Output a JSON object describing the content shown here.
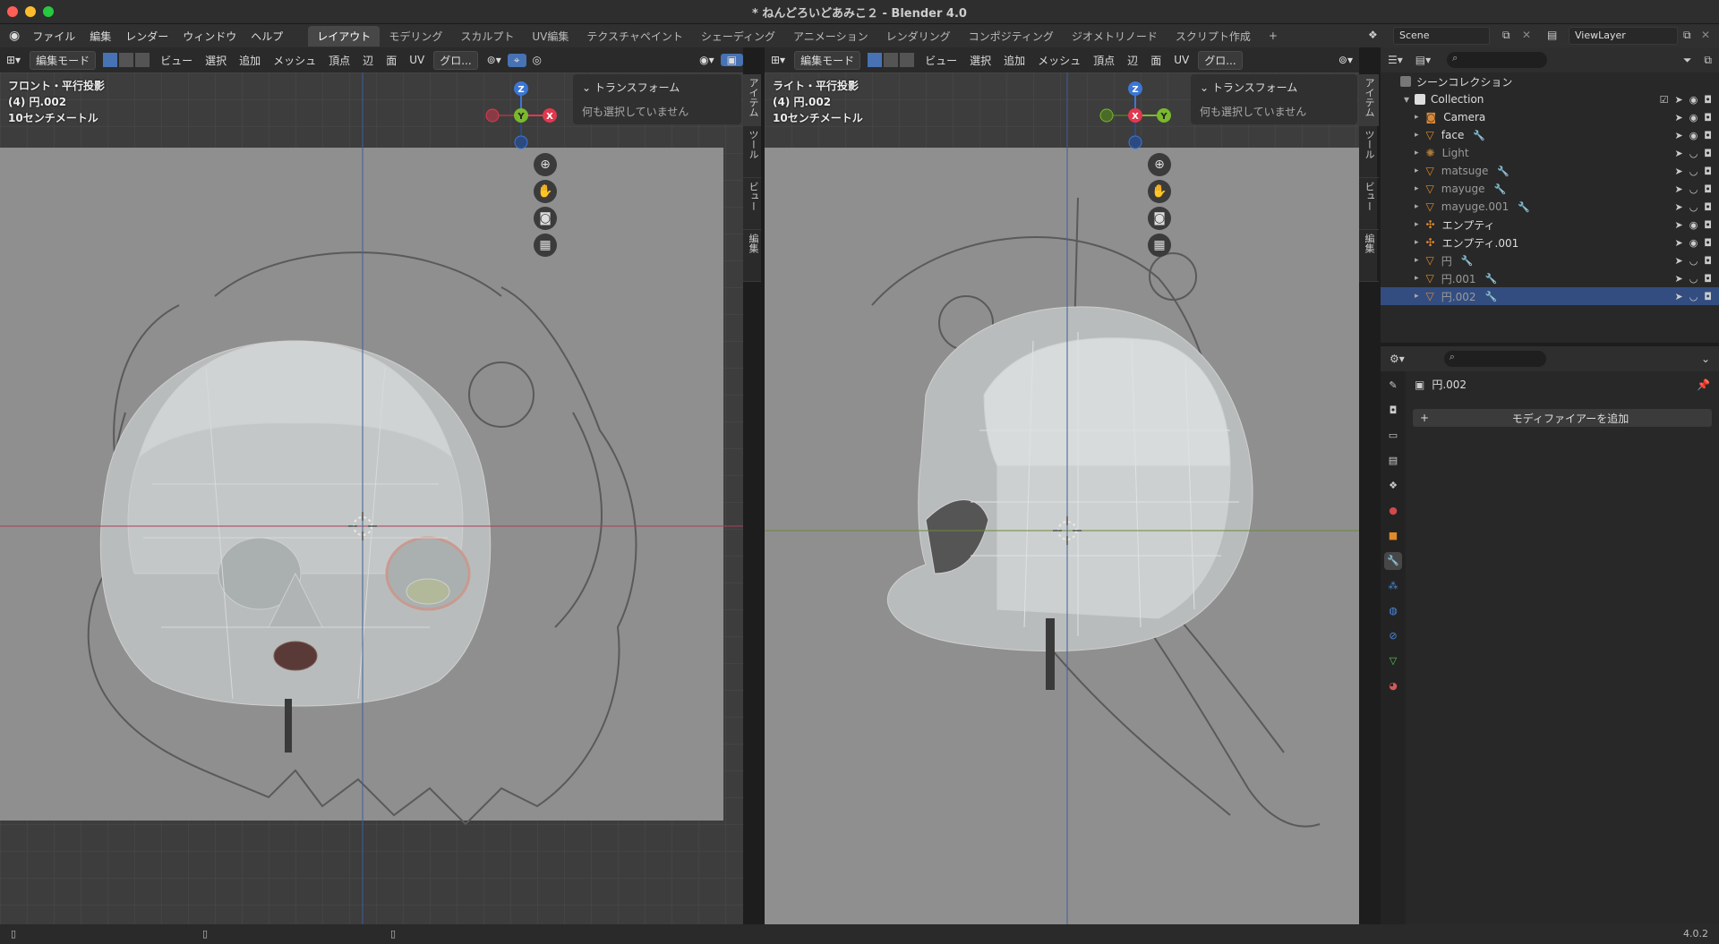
{
  "window": {
    "title": "* ねんどろいどあみこ２ - Blender 4.0"
  },
  "menus": [
    "ファイル",
    "編集",
    "レンダー",
    "ウィンドウ",
    "ヘルプ"
  ],
  "workspaces": [
    "レイアウト",
    "モデリング",
    "スカルプト",
    "UV編集",
    "テクスチャペイント",
    "シェーディング",
    "アニメーション",
    "レンダリング",
    "コンポジティング",
    "ジオメトリノード",
    "スクリプト作成"
  ],
  "workspace_add": "+",
  "scene": {
    "name": "Scene",
    "view_layer": "ViewLayer"
  },
  "viewport_left": {
    "mode": "編集モード",
    "menus": [
      "ビュー",
      "選択",
      "追加",
      "メッシュ",
      "頂点",
      "辺",
      "面",
      "UV"
    ],
    "transform_orient": "グロ...",
    "info_line1": "フロント・平行投影",
    "info_line2": "(4) 円.002",
    "info_line3": "10センチメートル",
    "panel_title": "トランスフォーム",
    "panel_body": "何も選択していません",
    "gizmo": {
      "top": "Z",
      "center": "Y",
      "right": "X"
    },
    "tabs": [
      "アイテム",
      "ツール",
      "ビュー",
      "編集"
    ]
  },
  "viewport_right": {
    "mode": "編集モード",
    "menus": [
      "ビュー",
      "選択",
      "追加",
      "メッシュ",
      "頂点",
      "辺",
      "面",
      "UV"
    ],
    "transform_orient": "グロ...",
    "info_line1": "ライト・平行投影",
    "info_line2": "(4) 円.002",
    "info_line3": "10センチメートル",
    "panel_title": "トランスフォーム",
    "panel_body": "何も選択していません",
    "gizmo": {
      "top": "Z",
      "center": "X",
      "right": "Y"
    },
    "tabs": [
      "アイテム",
      "ツール",
      "ビュー",
      "編集"
    ]
  },
  "outliner": {
    "root": "シーンコレクション",
    "collection": "Collection",
    "items": [
      {
        "name": "Camera",
        "type": "camera",
        "dim": false
      },
      {
        "name": "face",
        "type": "mesh",
        "dim": false
      },
      {
        "name": "Light",
        "type": "light",
        "dim": true
      },
      {
        "name": "matsuge",
        "type": "mesh",
        "dim": true
      },
      {
        "name": "mayuge",
        "type": "mesh",
        "dim": true
      },
      {
        "name": "mayuge.001",
        "type": "mesh",
        "dim": true
      },
      {
        "name": "エンプティ",
        "type": "empty",
        "dim": false
      },
      {
        "name": "エンプティ.001",
        "type": "empty",
        "dim": false
      },
      {
        "name": "円",
        "type": "mesh",
        "dim": true
      },
      {
        "name": "円.001",
        "type": "mesh",
        "dim": true
      },
      {
        "name": "円.002",
        "type": "mesh",
        "dim": true,
        "selected": true
      }
    ]
  },
  "properties": {
    "object_name": "円.002",
    "add_modifier": "モディファイアーを追加"
  },
  "status": {
    "version": "4.0.2"
  },
  "colors": {
    "accent": "#4772b3",
    "x_axis": "#e2384e",
    "y_axis": "#7ab82e",
    "z_axis": "#3c77d6"
  }
}
